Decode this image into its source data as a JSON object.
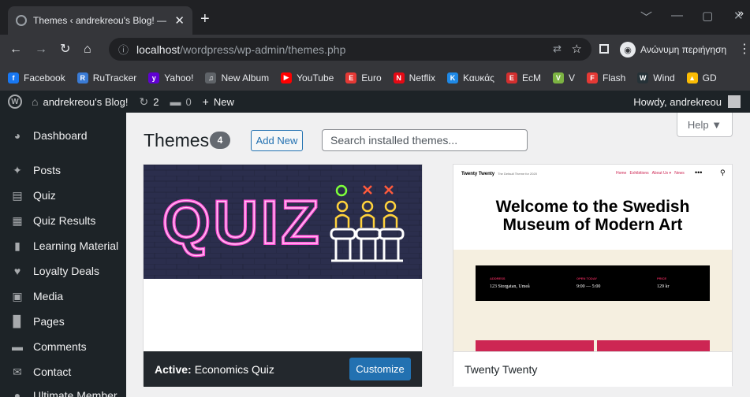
{
  "browser": {
    "tab_title": "Themes ‹ andrekreou's Blog! — W",
    "new_tab": "+",
    "win_min": "—",
    "win_max": "▢",
    "win_close": "✕",
    "url_host": "localhost",
    "url_path": "/wordpress/wp-admin/themes.php",
    "incognito_label": "Ανώνυμη περιήγηση",
    "bookmarks": [
      {
        "label": "Facebook",
        "color": "#1877f2",
        "glyph": "f"
      },
      {
        "label": "RuTracker",
        "color": "#3a7bd5",
        "glyph": "R"
      },
      {
        "label": "Yahoo!",
        "color": "#6001d2",
        "glyph": "y"
      },
      {
        "label": "New Album",
        "color": "#5f6368",
        "glyph": "♫"
      },
      {
        "label": "YouTube",
        "color": "#ff0000",
        "glyph": "▶"
      },
      {
        "label": "Euro",
        "color": "#e53935",
        "glyph": "E"
      },
      {
        "label": "Netflix",
        "color": "#e50914",
        "glyph": "N"
      },
      {
        "label": "Καυκάς",
        "color": "#1e88e5",
        "glyph": "K"
      },
      {
        "label": "EcM",
        "color": "#d32f2f",
        "glyph": "E"
      },
      {
        "label": "V",
        "color": "#7cb342",
        "glyph": "V"
      },
      {
        "label": "Flash",
        "color": "#e53935",
        "glyph": "F"
      },
      {
        "label": "Wind",
        "color": "#263238",
        "glyph": "W"
      },
      {
        "label": "GD",
        "color": "#fbbc04",
        "glyph": "▲"
      }
    ],
    "bookmarks_more": "»"
  },
  "adminbar": {
    "site_name": "andrekreou's Blog!",
    "updates": "2",
    "comments": "0",
    "new_label": "New",
    "howdy": "Howdy, andrekreou"
  },
  "sidebar": {
    "items": [
      {
        "label": "Dashboard",
        "icon": "dashboard-icon",
        "glyph": "◕"
      },
      {
        "label": "Posts",
        "icon": "pin-icon",
        "glyph": "✦"
      },
      {
        "label": "Quiz",
        "icon": "quiz-icon",
        "glyph": "▤"
      },
      {
        "label": "Quiz Results",
        "icon": "results-icon",
        "glyph": "▦"
      },
      {
        "label": "Learning Material",
        "icon": "book-icon",
        "glyph": "▮"
      },
      {
        "label": "Loyalty Deals",
        "icon": "heart-icon",
        "glyph": "♥"
      },
      {
        "label": "Media",
        "icon": "media-icon",
        "glyph": "▣"
      },
      {
        "label": "Pages",
        "icon": "pages-icon",
        "glyph": "▉"
      },
      {
        "label": "Comments",
        "icon": "comment-icon",
        "glyph": "▬"
      },
      {
        "label": "Contact",
        "icon": "mail-icon",
        "glyph": "✉"
      },
      {
        "label": "Ultimate Member",
        "icon": "user-icon",
        "glyph": "●"
      }
    ]
  },
  "main": {
    "title": "Themes",
    "count": "4",
    "add_new": "Add New",
    "search_placeholder": "Search installed themes...",
    "help": "Help ▼",
    "themes": [
      {
        "active_prefix": "Active:",
        "name": "Economics Quiz",
        "customize": "Customize",
        "screenshot_text": "QUIZ"
      },
      {
        "name": "Twenty Twenty",
        "shot_brand": "Twenty Twenty",
        "shot_tagline": "The Default Theme for 2020",
        "shot_nav": "Home   Exhibitions   About Us ▾   News",
        "shot_headline": "Welcome to the Swedish Museum of Modern Art",
        "shot_info": [
          {
            "label": "ADDRESS",
            "value": "123 Storgatan, Umeå"
          },
          {
            "label": "OPEN TODAY",
            "value": "9:00 — 5:00"
          },
          {
            "label": "PRICE",
            "value": "129 kr"
          }
        ]
      }
    ]
  }
}
